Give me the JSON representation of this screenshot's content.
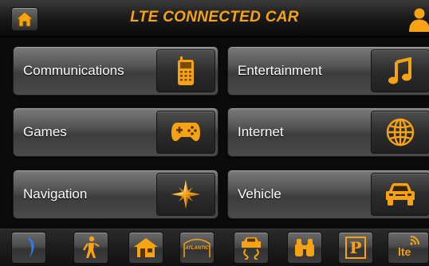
{
  "header": {
    "title": "LTE CONNECTED CAR",
    "home_icon": "home-icon",
    "profile_icon": "user-icon"
  },
  "tiles": [
    {
      "label": "Communications",
      "icon": "phone-icon"
    },
    {
      "label": "Entertainment",
      "icon": "music-note-icon"
    },
    {
      "label": "Games",
      "icon": "gamepad-icon"
    },
    {
      "label": "Internet",
      "icon": "globe-icon"
    },
    {
      "label": "Navigation",
      "icon": "compass-star-icon"
    },
    {
      "label": "Vehicle",
      "icon": "car-icon"
    }
  ],
  "bottom_bar": {
    "items": [
      {
        "icon": "moon-icon"
      },
      {
        "icon": "hiker-icon"
      },
      {
        "icon": "house-icon"
      },
      {
        "icon": "atlantic-logo-icon",
        "text": "ATLANTIC"
      },
      {
        "icon": "car-skid-icon"
      },
      {
        "icon": "binoculars-icon"
      },
      {
        "icon": "parking-icon",
        "text": "P"
      },
      {
        "icon": "lte-signal-icon",
        "text": "lte"
      }
    ]
  },
  "colors": {
    "accent": "#f5a312",
    "background": "#0b0b0b",
    "tile": "#555555"
  }
}
